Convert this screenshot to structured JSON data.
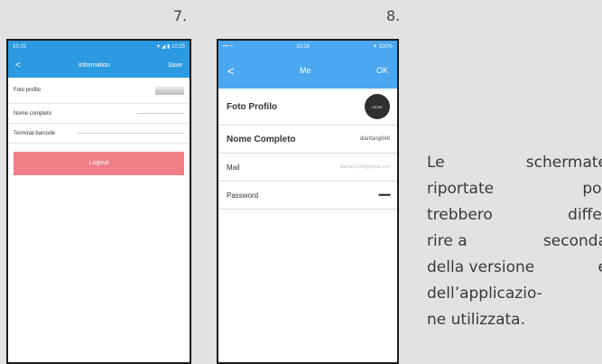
{
  "labels": {
    "step7": "7.",
    "step8": "8."
  },
  "screen7": {
    "status": {
      "left": "10:25",
      "right": "▾ ◢ ▮ 10:25"
    },
    "nav": {
      "back": "<",
      "title": "Information",
      "action": "Save"
    },
    "rows": [
      {
        "label": "Foto profilo"
      },
      {
        "label": "Nome completo"
      },
      {
        "label": "Terminal barcode"
      }
    ],
    "button": "Logout"
  },
  "screen8": {
    "status": {
      "left": "••• ≈",
      "center": "10:26",
      "right": "✦ 100%"
    },
    "nav": {
      "back": "<",
      "title": "Me",
      "action": "OK"
    },
    "rows": [
      {
        "label": "Foto Profilo",
        "value": ""
      },
      {
        "label": "Nome Completo",
        "value": "dianfang048"
      },
      {
        "label": "Mail",
        "value": "dianfang048@gmail.com"
      },
      {
        "label": "Password",
        "value": "••••••"
      }
    ],
    "avatar_text": "LEXIS"
  },
  "paragraph": {
    "lines": [
      [
        "Le",
        "schermate"
      ],
      [
        "riportate",
        "po-"
      ],
      [
        "trebbero",
        "diffe-"
      ],
      [
        "rire a",
        "seconda"
      ],
      [
        "della versione",
        "e"
      ],
      [
        "dell’applicazio-",
        ""
      ],
      [
        "ne utilizzata.",
        ""
      ]
    ]
  },
  "colors": {
    "accent7": "#2b9ae0",
    "accent8": "#4aa7f0",
    "logout": "#ef7e86"
  }
}
